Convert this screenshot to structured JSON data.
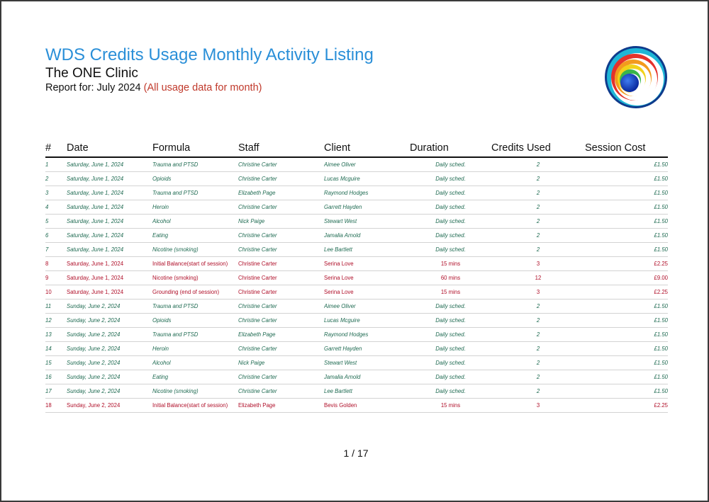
{
  "document": {
    "title": "WDS Credits Usage Monthly Activity Listing",
    "clinic": "The ONE Clinic",
    "report_label": "Report for:",
    "report_period": "July 2024",
    "report_note": "(All usage data for month)",
    "logo_icon": "concentric-rainbow-rings-logo",
    "page_indicator": "1 / 17"
  },
  "colors": {
    "title": "#2a8fd8",
    "scheduled_row": "#1f6b52",
    "session_row": "#b0102a",
    "note": "#c0392b"
  },
  "table": {
    "headers": [
      "#",
      "Date",
      "Formula",
      "Staff",
      "Client",
      "Duration",
      "Credits Used",
      "Session Cost"
    ],
    "rows": [
      {
        "kind": "sched",
        "cells": [
          "1",
          "Saturday, June 1, 2024",
          "Trauma and PTSD",
          "Christine Carter",
          "Aimee Oliver",
          "Daily sched.",
          "2",
          "£1.50"
        ]
      },
      {
        "kind": "sched",
        "cells": [
          "2",
          "Saturday, June 1, 2024",
          "Opioids",
          "Christine Carter",
          "Lucas Mcguire",
          "Daily sched.",
          "2",
          "£1.50"
        ]
      },
      {
        "kind": "sched",
        "cells": [
          "3",
          "Saturday, June 1, 2024",
          "Trauma and PTSD",
          "Elizabeth Page",
          "Raymond Hodges",
          "Daily sched.",
          "2",
          "£1.50"
        ]
      },
      {
        "kind": "sched",
        "cells": [
          "4",
          "Saturday, June 1, 2024",
          "Heroin",
          "Christine Carter",
          "Garrett Hayden",
          "Daily sched.",
          "2",
          "£1.50"
        ]
      },
      {
        "kind": "sched",
        "cells": [
          "5",
          "Saturday, June 1, 2024",
          "Alcohol",
          "Nick Paige",
          "Stewart West",
          "Daily sched.",
          "2",
          "£1.50"
        ]
      },
      {
        "kind": "sched",
        "cells": [
          "6",
          "Saturday, June 1, 2024",
          "Eating",
          "Christine Carter",
          "Jamalia Arnold",
          "Daily sched.",
          "2",
          "£1.50"
        ]
      },
      {
        "kind": "sched",
        "cells": [
          "7",
          "Saturday, June 1, 2024",
          "Nicotine (smoking)",
          "Christine Carter",
          "Lee Bartlett",
          "Daily sched.",
          "2",
          "£1.50"
        ]
      },
      {
        "kind": "session",
        "cells": [
          "8",
          "Saturday, June 1, 2024",
          "Initial Balance(start of session)",
          "Christine Carter",
          "Serina Love",
          "15 mins",
          "3",
          "£2.25"
        ]
      },
      {
        "kind": "session",
        "cells": [
          "9",
          "Saturday, June 1, 2024",
          "Nicotine (smoking)",
          "Christine Carter",
          "Serina Love",
          "60 mins",
          "12",
          "£9.00"
        ]
      },
      {
        "kind": "session",
        "cells": [
          "10",
          "Saturday, June 1, 2024",
          "Grounding (end of session)",
          "Christine Carter",
          "Serina Love",
          "15 mins",
          "3",
          "£2.25"
        ]
      },
      {
        "kind": "sched",
        "cells": [
          "11",
          "Sunday, June 2, 2024",
          "Trauma and PTSD",
          "Christine Carter",
          "Aimee Oliver",
          "Daily sched.",
          "2",
          "£1.50"
        ]
      },
      {
        "kind": "sched",
        "cells": [
          "12",
          "Sunday, June 2, 2024",
          "Opioids",
          "Christine Carter",
          "Lucas Mcguire",
          "Daily sched.",
          "2",
          "£1.50"
        ]
      },
      {
        "kind": "sched",
        "cells": [
          "13",
          "Sunday, June 2, 2024",
          "Trauma and PTSD",
          "Elizabeth Page",
          "Raymond Hodges",
          "Daily sched.",
          "2",
          "£1.50"
        ]
      },
      {
        "kind": "sched",
        "cells": [
          "14",
          "Sunday, June 2, 2024",
          "Heroin",
          "Christine Carter",
          "Garrett Hayden",
          "Daily sched.",
          "2",
          "£1.50"
        ]
      },
      {
        "kind": "sched",
        "cells": [
          "15",
          "Sunday, June 2, 2024",
          "Alcohol",
          "Nick Paige",
          "Stewart West",
          "Daily sched.",
          "2",
          "£1.50"
        ]
      },
      {
        "kind": "sched",
        "cells": [
          "16",
          "Sunday, June 2, 2024",
          "Eating",
          "Christine Carter",
          "Jamalia Arnold",
          "Daily sched.",
          "2",
          "£1.50"
        ]
      },
      {
        "kind": "sched",
        "cells": [
          "17",
          "Sunday, June 2, 2024",
          "Nicotine (smoking)",
          "Christine Carter",
          "Lee Bartlett",
          "Daily sched.",
          "2",
          "£1.50"
        ]
      },
      {
        "kind": "session",
        "cells": [
          "18",
          "Sunday, June 2, 2024",
          "Initial Balance(start of session)",
          "Elizabeth Page",
          "Bevis Golden",
          "15 mins",
          "3",
          "£2.25"
        ]
      }
    ]
  }
}
